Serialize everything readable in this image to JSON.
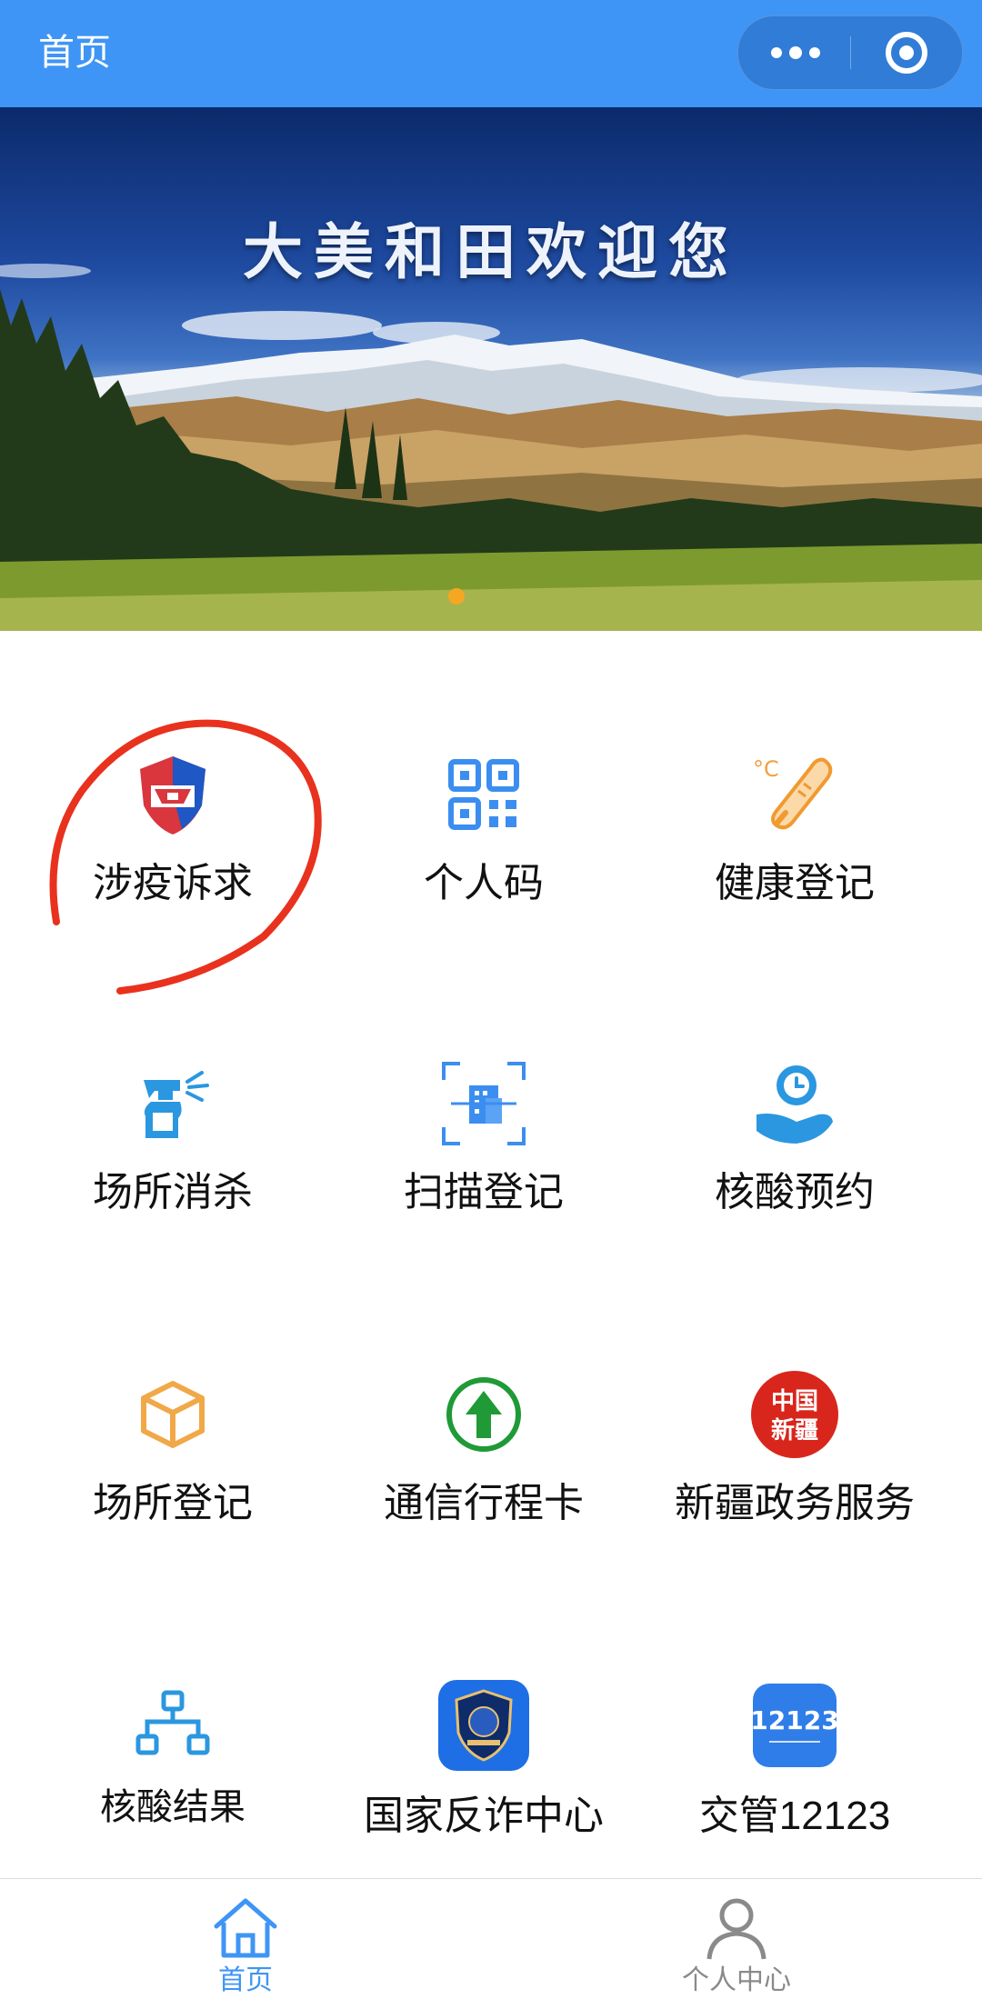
{
  "header": {
    "title": "首页"
  },
  "banner": {
    "title": "大美和田欢迎您"
  },
  "grid": {
    "items": [
      {
        "label": "涉疫诉求",
        "icon": "shield-icon"
      },
      {
        "label": "个人码",
        "icon": "qr-code-icon"
      },
      {
        "label": "健康登记",
        "icon": "thermometer-icon"
      },
      {
        "label": "场所消杀",
        "icon": "spray-bottle-icon"
      },
      {
        "label": "扫描登记",
        "icon": "scan-building-icon"
      },
      {
        "label": "核酸预约",
        "icon": "clock-hand-icon"
      },
      {
        "label": "场所登记",
        "icon": "cube-icon"
      },
      {
        "label": "通信行程卡",
        "icon": "up-arrow-circle-icon"
      },
      {
        "label": "新疆政务服务",
        "icon": "xinjiang-gov-icon"
      },
      {
        "label": "核酸结果",
        "icon": "org-chart-icon"
      },
      {
        "label": "国家反诈中心",
        "icon": "anti-fraud-badge-icon"
      },
      {
        "label": "交管12123",
        "icon": "traffic-12123-icon"
      }
    ],
    "xinjiang_logo_text": [
      "中国",
      "新疆"
    ],
    "traffic_logo_text": "12123"
  },
  "tabbar": {
    "items": [
      {
        "label": "首页",
        "icon": "home-icon",
        "active": true
      },
      {
        "label": "个人中心",
        "icon": "user-icon",
        "active": false
      }
    ]
  },
  "colors": {
    "header_bg": "#3f95f5",
    "accent_blue": "#3f95f5",
    "active_tab": "#3f95f5",
    "inactive_tab": "#8a8a8a",
    "annotation_red": "#e8321e"
  }
}
